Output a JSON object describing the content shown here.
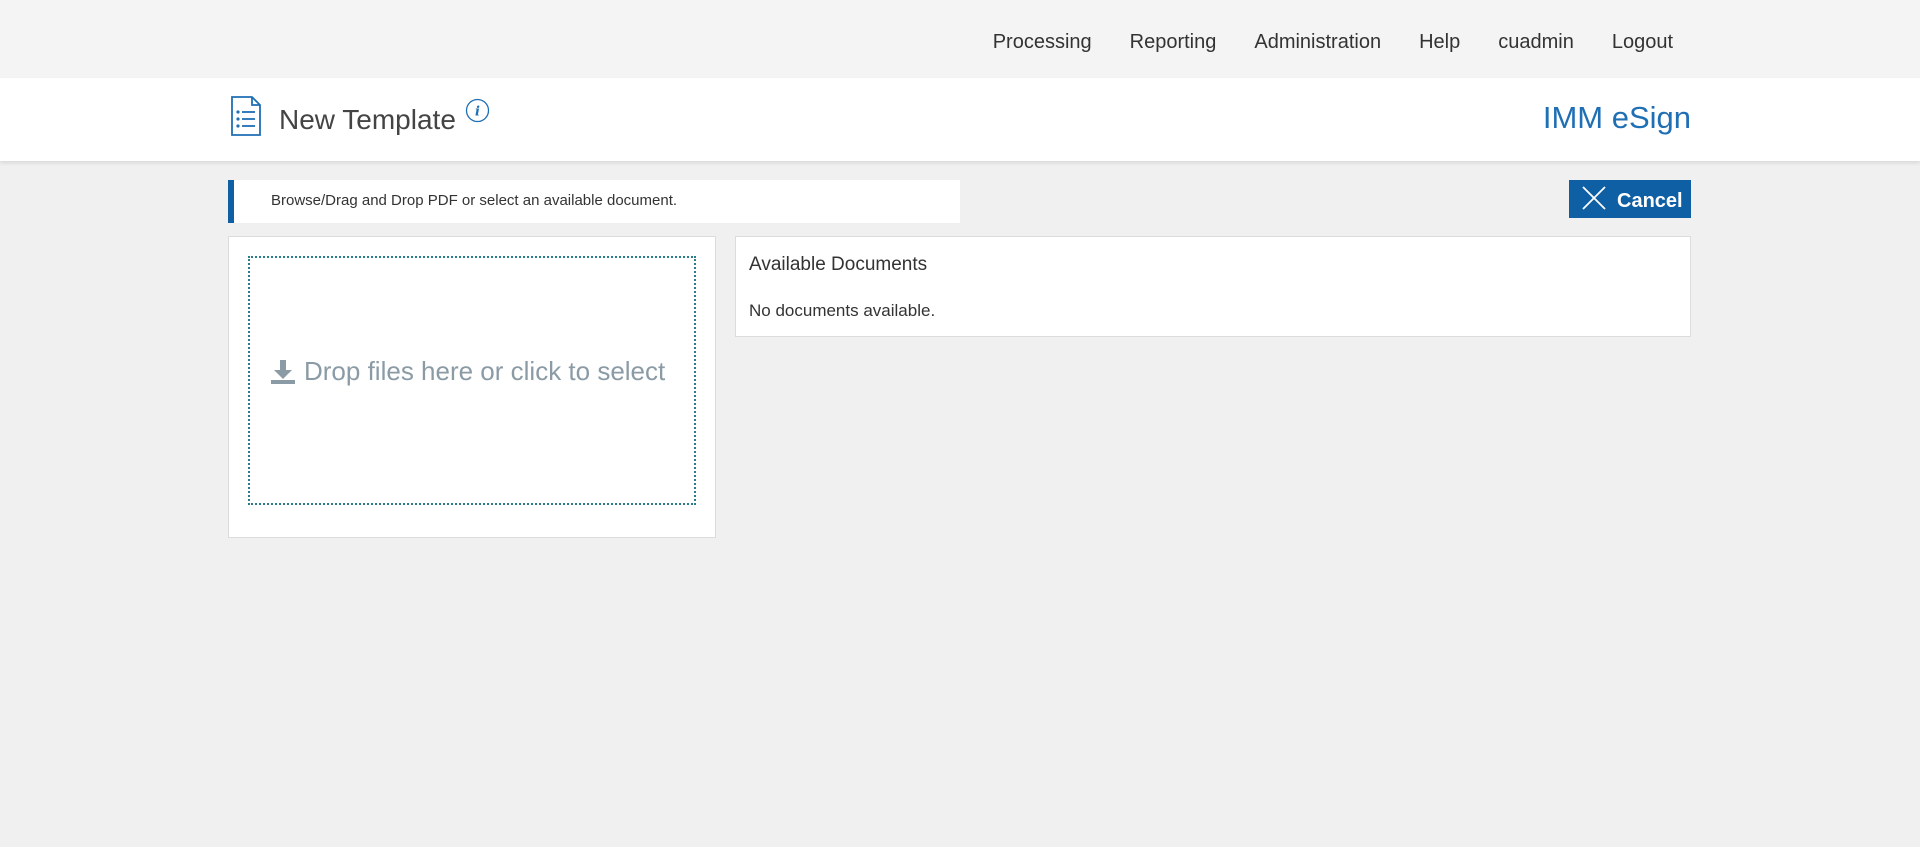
{
  "nav": {
    "items": [
      {
        "label": "Processing",
        "icon": ""
      },
      {
        "label": "Reporting",
        "icon": ""
      },
      {
        "label": "Administration",
        "icon": ""
      },
      {
        "label": "Help",
        "icon": ""
      },
      {
        "label": "cuadmin",
        "icon": ""
      },
      {
        "label": "Logout",
        "icon": ""
      }
    ]
  },
  "header": {
    "title": "New Template",
    "title_icon": "document-list-icon",
    "info_icon": "info-icon",
    "brand": "IMM eSign"
  },
  "banner": {
    "text": "Browse/Drag and Drop PDF or select an available document."
  },
  "actions": {
    "cancel_label": "Cancel",
    "cancel_icon": "close-icon"
  },
  "upload": {
    "prompt": "Drop files here or click to select",
    "icon": "download-icon"
  },
  "documents": {
    "title": "Available Documents",
    "empty_message": "No documents available."
  },
  "colors": {
    "accent": "#0f5fa4",
    "brand": "#1f6fb5",
    "dropzone_border": "#2a7d8a",
    "dropzone_text": "#8a9ba6",
    "page_bg": "#f0f0f0",
    "nav_bg": "#f4f4f4"
  }
}
